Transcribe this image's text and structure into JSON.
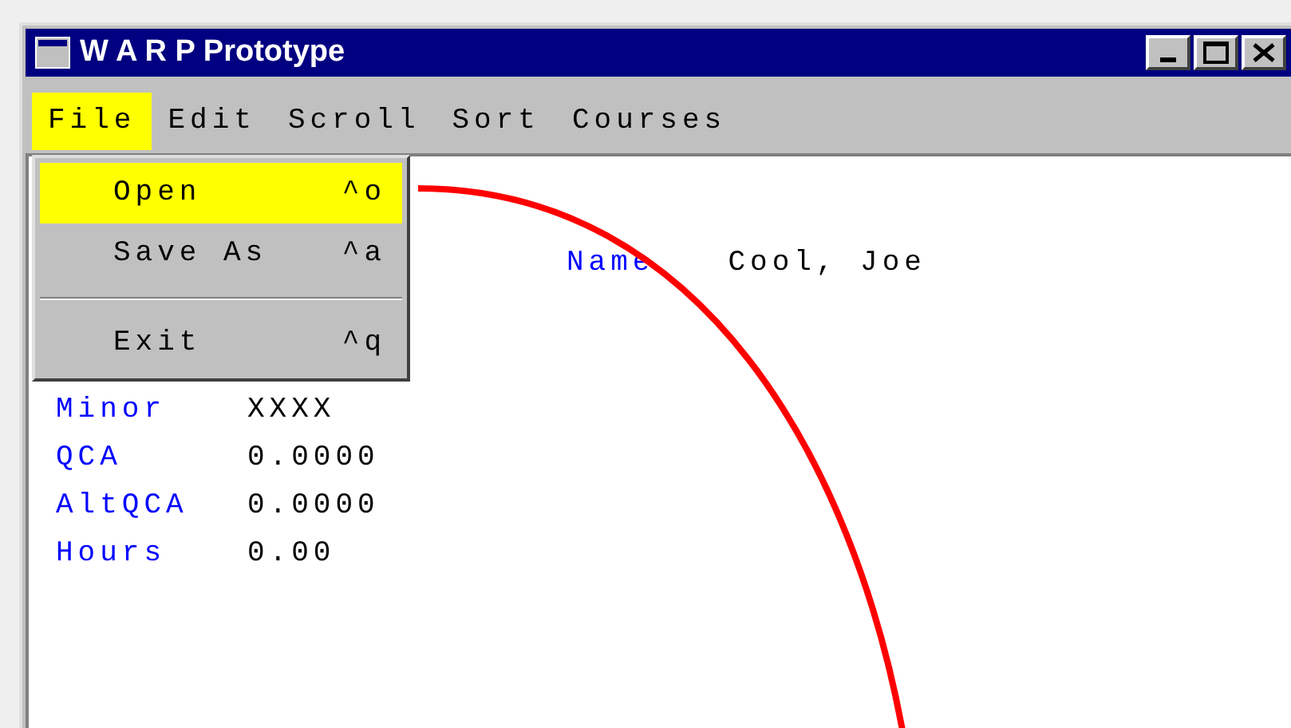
{
  "window": {
    "title": "W A R P Prototype"
  },
  "menu_bar": [
    {
      "label": "File",
      "selected": true
    },
    {
      "label": "Edit",
      "selected": false
    },
    {
      "label": "Scroll",
      "selected": false
    },
    {
      "label": "Sort",
      "selected": false
    },
    {
      "label": "Courses",
      "selected": false
    }
  ],
  "open_menu": {
    "items": [
      {
        "kind": "item",
        "label": "Open",
        "shortcut": "^o",
        "selected": true
      },
      {
        "kind": "item",
        "label": "Save As",
        "shortcut": "^a",
        "selected": false
      },
      {
        "kind": "separator"
      },
      {
        "kind": "item",
        "label": "Exit",
        "shortcut": "^q",
        "selected": false
      }
    ]
  },
  "name_field": {
    "label": "Name",
    "value": "Cool, Joe"
  },
  "fields": [
    {
      "label": "Minor",
      "value": "XXXX"
    },
    {
      "label": "QCA",
      "value": "0.0000"
    },
    {
      "label": "AltQCA",
      "value": "0.0000"
    },
    {
      "label": "Hours",
      "value": "0.00"
    }
  ]
}
